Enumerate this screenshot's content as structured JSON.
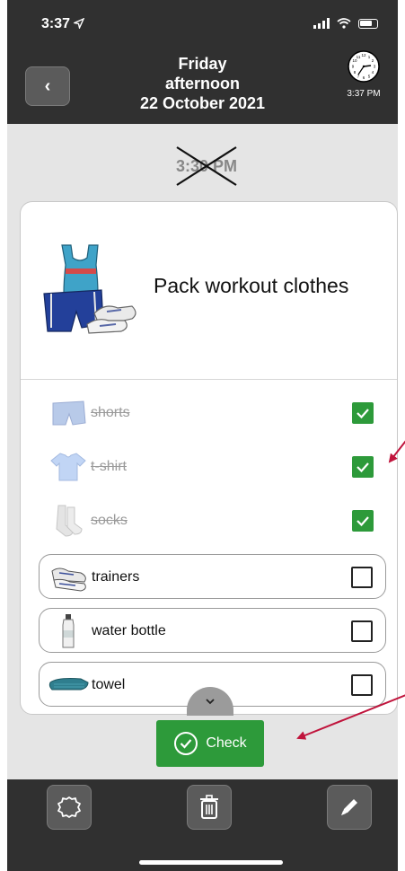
{
  "status_bar": {
    "time": "3:37",
    "location_arrow": "location-arrow-icon"
  },
  "header": {
    "back_label": "‹",
    "day": "Friday",
    "period": "afternoon",
    "date": "22 October 2021",
    "clock_time": "3:37 PM"
  },
  "scheduled_time": "3:30 PM",
  "task": {
    "title": "Pack workout clothes",
    "image": "workout-clothes-image"
  },
  "items": [
    {
      "label": "shorts",
      "checked": true,
      "icon": "shorts-icon"
    },
    {
      "label": "t-shirt",
      "checked": true,
      "icon": "tshirt-icon"
    },
    {
      "label": "socks",
      "checked": true,
      "icon": "socks-icon"
    },
    {
      "label": "trainers",
      "checked": false,
      "icon": "trainers-icon"
    },
    {
      "label": "water bottle",
      "checked": false,
      "icon": "water-bottle-icon"
    },
    {
      "label": "towel",
      "checked": false,
      "icon": "towel-icon"
    }
  ],
  "check_button": {
    "label": "Check"
  },
  "colors": {
    "bar": "#303030",
    "accent_green": "#2d9a3a",
    "annotation": "#c0143c",
    "background": "#e5e5e5"
  },
  "toolbar": [
    "alarm-icon",
    "trash-icon",
    "pencil-icon"
  ]
}
